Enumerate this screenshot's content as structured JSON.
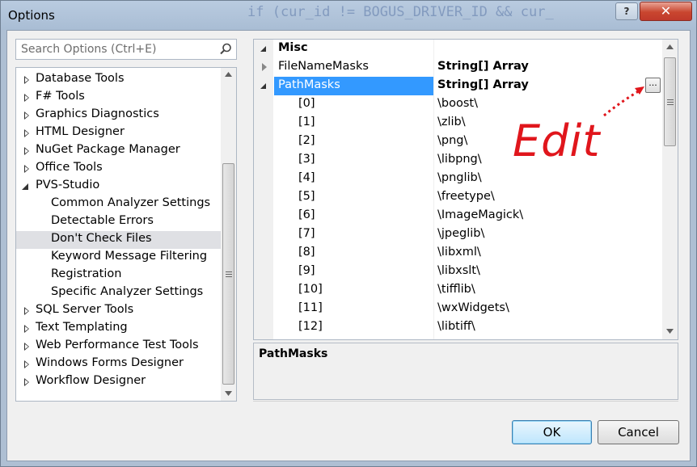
{
  "window": {
    "title": "Options",
    "background_code": "if (cur_id != BOGUS_DRIVER_ID && cur_",
    "help_label": "?",
    "close_label": "✕"
  },
  "search": {
    "placeholder": "Search Options (Ctrl+E)"
  },
  "tree": {
    "items": [
      {
        "label": "Database Tools",
        "level": 0,
        "expanded": false
      },
      {
        "label": "F# Tools",
        "level": 0,
        "expanded": false
      },
      {
        "label": "Graphics Diagnostics",
        "level": 0,
        "expanded": false
      },
      {
        "label": "HTML Designer",
        "level": 0,
        "expanded": false
      },
      {
        "label": "NuGet Package Manager",
        "level": 0,
        "expanded": false
      },
      {
        "label": "Office Tools",
        "level": 0,
        "expanded": false
      },
      {
        "label": "PVS-Studio",
        "level": 0,
        "expanded": true
      },
      {
        "label": "Common Analyzer Settings",
        "level": 1
      },
      {
        "label": "Detectable Errors",
        "level": 1
      },
      {
        "label": "Don't Check Files",
        "level": 1,
        "selected": true
      },
      {
        "label": "Keyword Message Filtering",
        "level": 1
      },
      {
        "label": "Registration",
        "level": 1
      },
      {
        "label": "Specific Analyzer Settings",
        "level": 1
      },
      {
        "label": "SQL Server Tools",
        "level": 0,
        "expanded": false
      },
      {
        "label": "Text Templating",
        "level": 0,
        "expanded": false
      },
      {
        "label": "Web Performance Test Tools",
        "level": 0,
        "expanded": false
      },
      {
        "label": "Windows Forms Designer",
        "level": 0,
        "expanded": false
      },
      {
        "label": "Workflow Designer",
        "level": 0,
        "expanded": false
      }
    ]
  },
  "grid": {
    "category": "Misc",
    "properties": [
      {
        "name": "FileNameMasks",
        "value": "String[] Array",
        "expanded": false
      },
      {
        "name": "PathMasks",
        "value": "String[] Array",
        "expanded": true,
        "selected": true
      }
    ],
    "entries": [
      {
        "index": "[0]",
        "value": "\\boost\\"
      },
      {
        "index": "[1]",
        "value": "\\zlib\\"
      },
      {
        "index": "[2]",
        "value": "\\png\\"
      },
      {
        "index": "[3]",
        "value": "\\libpng\\"
      },
      {
        "index": "[4]",
        "value": "\\pnglib\\"
      },
      {
        "index": "[5]",
        "value": "\\freetype\\"
      },
      {
        "index": "[6]",
        "value": "\\ImageMagick\\"
      },
      {
        "index": "[7]",
        "value": "\\jpeglib\\"
      },
      {
        "index": "[8]",
        "value": "\\libxml\\"
      },
      {
        "index": "[9]",
        "value": "\\libxslt\\"
      },
      {
        "index": "[10]",
        "value": "\\tifflib\\"
      },
      {
        "index": "[11]",
        "value": "\\wxWidgets\\"
      },
      {
        "index": "[12]",
        "value": "\\libtiff\\"
      }
    ],
    "ellipsis_label": "..."
  },
  "description": {
    "title": "PathMasks"
  },
  "annotation": {
    "text": "Edit",
    "color": "#e0161c"
  },
  "buttons": {
    "ok": "OK",
    "cancel": "Cancel"
  },
  "colors": {
    "selection": "#3399ff",
    "tree_selection": "#dfe0e4",
    "window_frame": "#aebfd3"
  }
}
